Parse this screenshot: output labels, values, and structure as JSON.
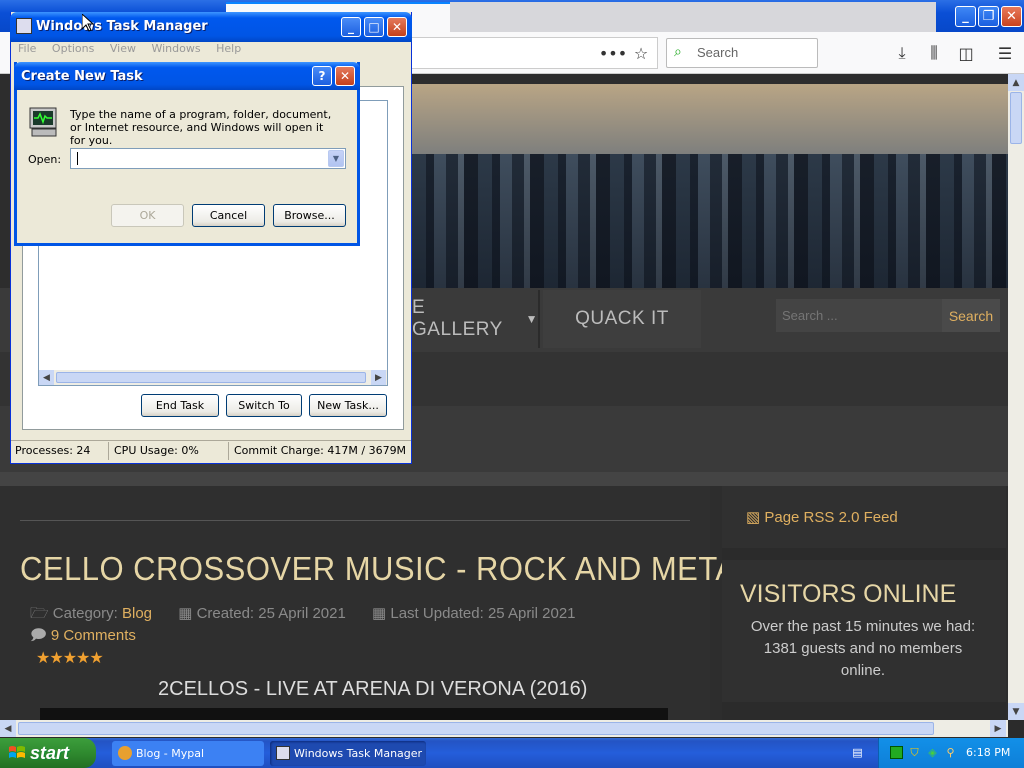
{
  "firefox": {
    "search_placeholder": "Search",
    "window_controls": [
      "minimize",
      "restore",
      "close"
    ],
    "toolbar_icons": [
      "more-icon",
      "bookmark-star-icon",
      "download-icon",
      "library-icon",
      "sidebar-icon",
      "menu-icon"
    ]
  },
  "site": {
    "nav": {
      "gallery": "E GALLERY",
      "quack": "QUACK IT"
    },
    "search": {
      "placeholder": "Search ...",
      "button": "Search"
    },
    "article": {
      "title": "CELLO CROSSOVER MUSIC - ROCK AND METAL",
      "category_label": "Category:",
      "category_value": "Blog",
      "created": "Created: 25 April 2021",
      "updated": "Last Updated: 25 April 2021",
      "comments": "9 Comments",
      "rating_stars": 5,
      "video_title": "2CELLOS - LIVE AT ARENA DI VERONA (2016)"
    },
    "sidebar": {
      "rss": "Page RSS 2.0 Feed",
      "visitors_title": "VISITORS ONLINE",
      "visitors_text": "Over the past 15 minutes we had: 1381 guests and no members online."
    }
  },
  "task_manager": {
    "title": "Windows Task Manager",
    "menu": [
      "File",
      "Options",
      "View",
      "Windows",
      "Help"
    ],
    "buttons": {
      "end_task": "End Task",
      "switch_to": "Switch To",
      "new_task": "New Task..."
    },
    "status": {
      "processes": "Processes: 24",
      "cpu": "CPU Usage: 0%",
      "commit": "Commit Charge: 417M / 3679M"
    }
  },
  "create_new_task": {
    "title": "Create New Task",
    "description": "Type the name of a program, folder, document, or Internet resource, and Windows will open it for you.",
    "open_label": "Open:",
    "open_value": "",
    "buttons": {
      "ok": "OK",
      "cancel": "Cancel",
      "browse": "Browse..."
    }
  },
  "taskbar": {
    "start": "start",
    "items": [
      "Blog - Mypal",
      "Windows Task Manager"
    ],
    "clock": "6:18 PM"
  },
  "colors": {
    "accent": "#e0b060",
    "xp_blue": "#0055e5",
    "start_green": "#2f8a2f"
  }
}
